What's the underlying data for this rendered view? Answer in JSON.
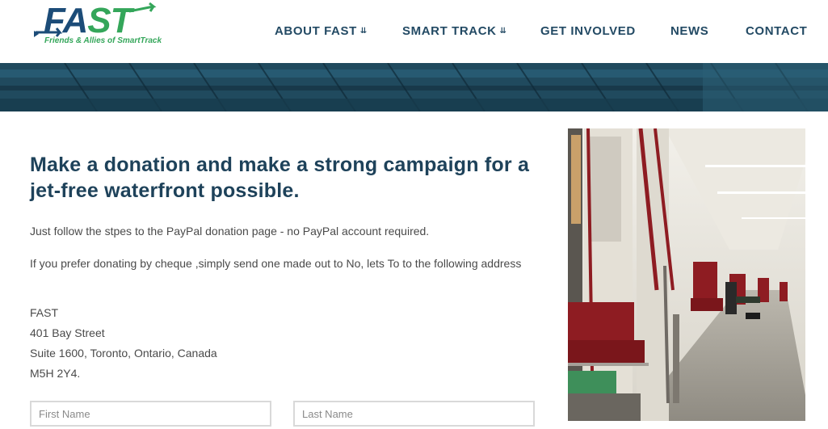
{
  "logo": {
    "word_part1": "FA",
    "word_part2": "ST",
    "tagline": "Friends & Allies of SmartTrack"
  },
  "nav": {
    "items": [
      {
        "label": "ABOUT FAST",
        "has_dropdown": true
      },
      {
        "label": "SMART TRACK",
        "has_dropdown": true
      },
      {
        "label": "GET INVOLVED",
        "has_dropdown": false
      },
      {
        "label": "NEWS",
        "has_dropdown": false
      },
      {
        "label": "CONTACT",
        "has_dropdown": false
      }
    ],
    "dropdown_icon": "chevron-double-down-icon"
  },
  "main": {
    "heading": "Make a donation and make a strong campaign for a jet-free waterfront possible.",
    "paypal_text": "Just follow the stpes to the PayPal donation page - no PayPal account required.",
    "cheque_text": "If you prefer donating by cheque ,simply send one made out to No, lets To to the following address",
    "address": [
      "FAST",
      "401 Bay Street",
      "Suite 1600, Toronto, Ontario, Canada",
      "M5H 2Y4."
    ]
  },
  "form": {
    "first_name_placeholder": "First Name",
    "last_name_placeholder": "Last Name"
  },
  "colors": {
    "brand_blue": "#1c4c78",
    "brand_green": "#34a65a",
    "nav_text": "#234a64",
    "heading_text": "#1e425a",
    "banner_teal": "#25556c",
    "seat_red": "#8e1c22"
  }
}
